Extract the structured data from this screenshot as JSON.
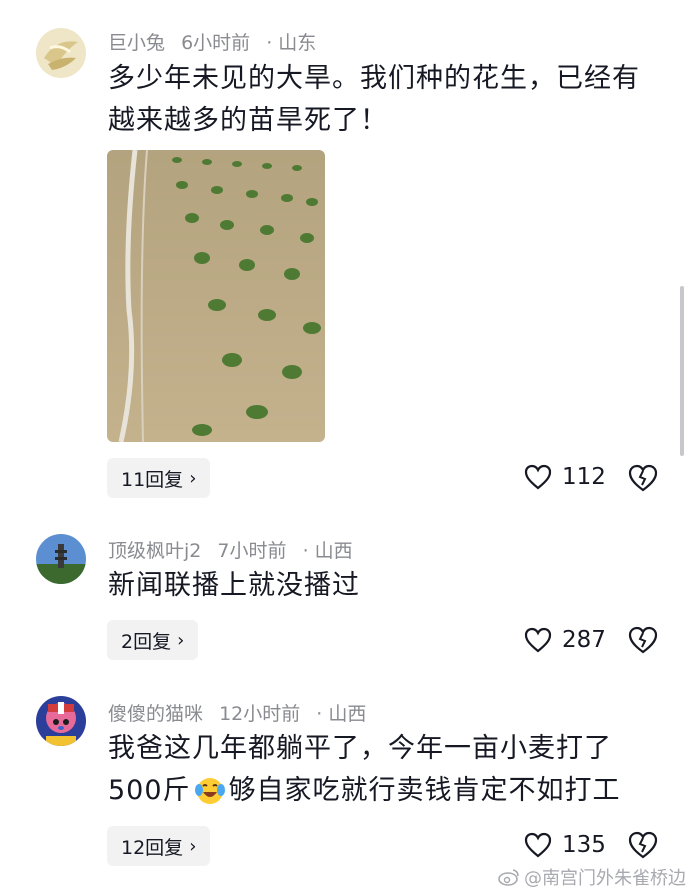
{
  "comments": [
    {
      "username": "巨小兔",
      "time": "6小时前",
      "location": "· 山东",
      "text_lines": [
        "多少年未见的大旱。我们种的花生，已经有",
        "越来越多的苗旱死了！"
      ],
      "reply_label": "11回复",
      "likes": "112",
      "has_photo": true
    },
    {
      "username": "顶级枫叶j2",
      "time": "7小时前",
      "location": "· 山西",
      "text_lines": [
        "新闻联播上就没播过"
      ],
      "reply_label": "2回复",
      "likes": "287"
    },
    {
      "username": "傻傻的猫咪",
      "time": "12小时前",
      "location": "· 山西",
      "text_lines": [
        "我爸这几年都躺平了，今年一亩小麦打了",
        "500斤",
        "够自家吃就行卖钱肯定不如打工"
      ],
      "reply_label": "12回复",
      "likes": "135"
    }
  ],
  "icons": {
    "like": "heart-outline-icon",
    "dislike": "broken-heart-icon",
    "expand": "chevron-right-icon"
  },
  "watermark": "@南宫门外朱雀桥边",
  "colors": {
    "meta": "#8a8b91",
    "text": "#161823",
    "reply_bg": "#f2f2f3"
  }
}
